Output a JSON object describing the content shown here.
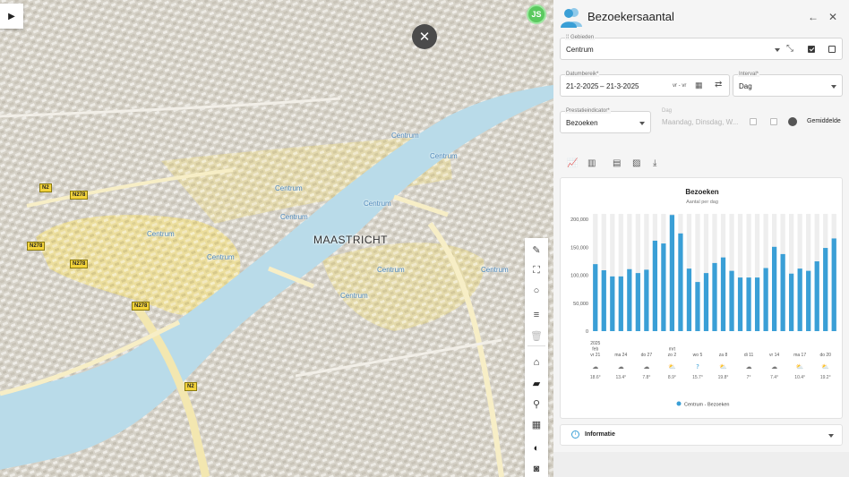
{
  "map": {
    "city_label": "MAASTRICHT",
    "area_label": "Centrum",
    "area_label_positions_note": "",
    "road_shields": [
      "N2",
      "N278",
      "N278",
      "N278",
      "N278",
      "N2",
      "N278",
      "N278"
    ],
    "avatar_initials": "JS",
    "colors": {
      "water": "#b9dbe9",
      "highlight": "#f5e7a0",
      "road": "#f7eec6"
    }
  },
  "tools": [
    {
      "name": "ruler-icon",
      "glyph": "✎",
      "state": "normal"
    },
    {
      "name": "polygon-icon",
      "glyph": "⛶",
      "state": "normal"
    },
    {
      "name": "circle-icon",
      "glyph": "○",
      "state": "normal"
    },
    {
      "name": "list-icon",
      "glyph": "≡",
      "state": "normal"
    },
    {
      "name": "trash-icon",
      "glyph": "🗑",
      "state": "dim"
    },
    {
      "name": "home-icon",
      "glyph": "⌂",
      "state": "dark"
    },
    {
      "name": "comment-icon",
      "glyph": "▰",
      "state": "dark"
    },
    {
      "name": "person-pin-icon",
      "glyph": "⚲",
      "state": "normal"
    },
    {
      "name": "grid-icon",
      "glyph": "▦",
      "state": "normal"
    },
    {
      "name": "contrast-icon",
      "glyph": "◐",
      "state": "dark"
    },
    {
      "name": "camera-icon",
      "glyph": "◙",
      "state": "normal"
    }
  ],
  "panel": {
    "title": "Bezoekersaantal",
    "gebieden": {
      "label": "Gebieden",
      "value": "Centrum"
    },
    "datumbereik": {
      "label": "Datumbereik*",
      "start": "21-2-2025",
      "sep": "–",
      "end": "21-3-2025",
      "days": "vr - vr"
    },
    "interval": {
      "label": "Interval*",
      "value": "Dag"
    },
    "prestatie": {
      "label": "Prestatieindicator*",
      "value": "Bezoeken"
    },
    "dag": {
      "label": "Dag",
      "value": "Maandag, Dinsdag, W..."
    },
    "gemiddelde": "Gemiddelde",
    "info_label": "Informatie"
  },
  "chart_data": {
    "type": "bar",
    "title": "Bezoeken",
    "subtitle": "Aantal per dag",
    "ylim": [
      0,
      210000
    ],
    "yticks": [
      "200,000",
      "150,000",
      "100,000",
      "50,000",
      "0"
    ],
    "ytick_values": [
      200000,
      150000,
      100000,
      50000,
      0
    ],
    "values": [
      120000,
      109000,
      98000,
      98000,
      111000,
      104000,
      110000,
      162000,
      157000,
      208000,
      175000,
      112000,
      88000,
      104000,
      122000,
      132000,
      108000,
      96000,
      96000,
      96000,
      113000,
      151000,
      138000,
      103000,
      112000,
      108000,
      125000,
      149000,
      166000
    ],
    "xtick_labels": [
      {
        "index": 0,
        "lines": [
          "2025",
          "feb",
          "vr 21"
        ]
      },
      {
        "index": 3,
        "lines": [
          "ma 24"
        ]
      },
      {
        "index": 6,
        "lines": [
          "do 27"
        ]
      },
      {
        "index": 9,
        "lines": [
          "mrt",
          "zo 2"
        ]
      },
      {
        "index": 12,
        "lines": [
          "wo 5"
        ]
      },
      {
        "index": 15,
        "lines": [
          "za 8"
        ]
      },
      {
        "index": 18,
        "lines": [
          "di 11"
        ]
      },
      {
        "index": 21,
        "lines": [
          "vr 14"
        ]
      },
      {
        "index": 24,
        "lines": [
          "ma 17"
        ]
      },
      {
        "index": 27,
        "lines": [
          "do 20"
        ]
      }
    ],
    "weather": [
      {
        "index": 0,
        "icon": "cloud-icon",
        "temp": "18.6°"
      },
      {
        "index": 3,
        "icon": "cloud-icon",
        "temp": "13.4°"
      },
      {
        "index": 6,
        "icon": "cloud-icon",
        "temp": "7.8°"
      },
      {
        "index": 9,
        "icon": "partly-sunny-icon",
        "temp": "8.9°"
      },
      {
        "index": 12,
        "icon": "unknown-weather-icon",
        "temp": "15.7°"
      },
      {
        "index": 15,
        "icon": "partly-sunny-icon",
        "temp": "19.8°"
      },
      {
        "index": 18,
        "icon": "cloud-icon",
        "temp": "7°"
      },
      {
        "index": 21,
        "icon": "cloud-icon",
        "temp": "7.4°"
      },
      {
        "index": 24,
        "icon": "partly-sunny-icon",
        "temp": "10.4°"
      },
      {
        "index": 27,
        "icon": "partly-sunny-icon",
        "temp": "19.2°"
      }
    ],
    "legend": "Centrum - Bezoeken",
    "legend_position": "bottom-center",
    "colors": {
      "bar": "#3a9fd6",
      "bg_band": "#eeeeee"
    },
    "grid": false
  }
}
